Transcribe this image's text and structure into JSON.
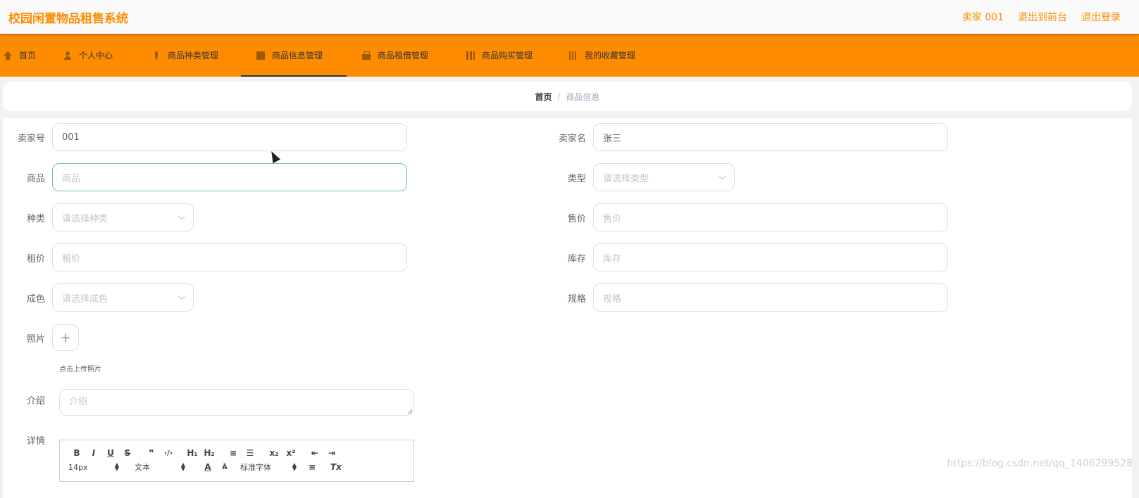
{
  "header": {
    "title": "校园闲置物品租售系统",
    "links": [
      "卖家 001",
      "退出到前台",
      "退出登录"
    ]
  },
  "nav": {
    "items": [
      {
        "label": "首页",
        "icon": "home-icon"
      },
      {
        "label": "个人中心",
        "icon": "user-icon"
      },
      {
        "label": "商品种类管理",
        "icon": "mic-icon"
      },
      {
        "label": "商品信息管理",
        "icon": "box-icon",
        "active": true
      },
      {
        "label": "商品租借管理",
        "icon": "bag-icon"
      },
      {
        "label": "商品购买管理",
        "icon": "grid-icon"
      },
      {
        "label": "我的收藏管理",
        "icon": "favorites-icon"
      }
    ]
  },
  "breadcrumb": {
    "home": "首页",
    "separator": "/",
    "current": "商品信息"
  },
  "form": {
    "seller_no": {
      "label": "卖家号",
      "value": "001"
    },
    "seller_name": {
      "label": "卖家名",
      "value": "张三"
    },
    "product": {
      "label": "商品",
      "placeholder": "商品"
    },
    "type": {
      "label": "类型",
      "placeholder": "请选择类型"
    },
    "category": {
      "label": "种类",
      "placeholder": "请选择种类"
    },
    "price": {
      "label": "售价",
      "placeholder": "售价"
    },
    "rent": {
      "label": "租价",
      "placeholder": "租价"
    },
    "stock": {
      "label": "库存",
      "placeholder": "库存"
    },
    "condition": {
      "label": "成色",
      "placeholder": "请选择成色"
    },
    "spec": {
      "label": "规格",
      "placeholder": "规格"
    },
    "photo": {
      "label": "照片",
      "upload_icon": "+",
      "tip": "点击上传照片"
    },
    "intro": {
      "label": "介绍",
      "placeholder": "介绍"
    },
    "detail": {
      "label": "详情"
    }
  },
  "editor": {
    "row1": [
      "B",
      "I",
      "U",
      "S",
      "❞",
      "‹/›",
      "H₁",
      "H₂",
      "≡",
      "☰",
      "x₂",
      "x²",
      "⇤",
      "⇥"
    ],
    "size": "14px",
    "format": "文本",
    "font": "标准字体",
    "row2_icons": [
      "A",
      "Ā",
      "≡",
      "Tx"
    ]
  },
  "watermark": "https://blog.csdn.net/qq_1406299528",
  "colors": {
    "accent": "#ff8c00",
    "focus_border": "#6bc4b4"
  }
}
